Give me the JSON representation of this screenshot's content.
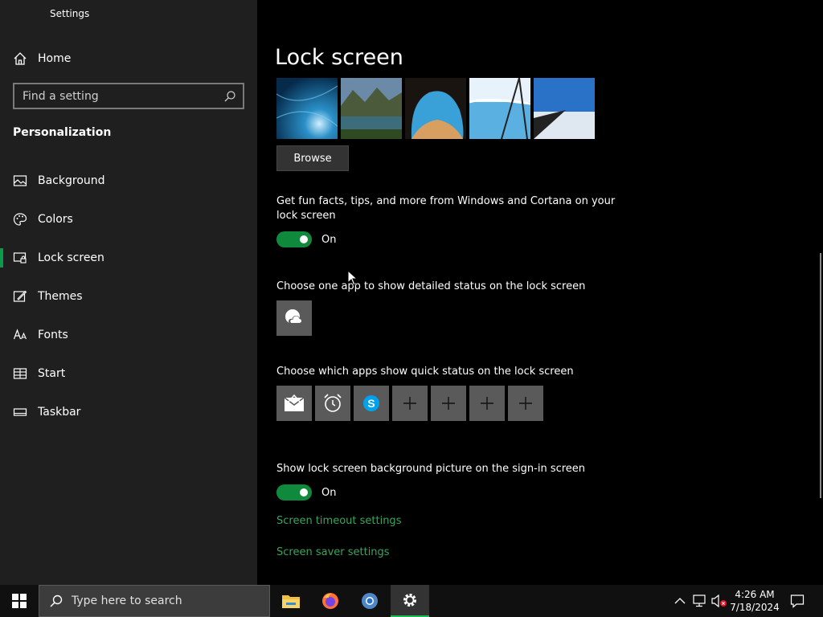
{
  "window": {
    "title": "Settings"
  },
  "sidebar": {
    "home_label": "Home",
    "search_placeholder": "Find a setting",
    "section_title": "Personalization",
    "items": [
      {
        "label": "Background",
        "icon": "image-icon"
      },
      {
        "label": "Colors",
        "icon": "palette-icon"
      },
      {
        "label": "Lock screen",
        "icon": "lock-screen-icon",
        "selected": true
      },
      {
        "label": "Themes",
        "icon": "brush-icon"
      },
      {
        "label": "Fonts",
        "icon": "font-icon"
      },
      {
        "label": "Start",
        "icon": "start-grid-icon"
      },
      {
        "label": "Taskbar",
        "icon": "taskbar-icon"
      }
    ]
  },
  "main": {
    "title": "Lock screen",
    "browse_label": "Browse",
    "fun_facts_text": "Get fun facts, tips, and more from Windows and Cortana on your lock screen",
    "fun_facts_toggle": "On",
    "detailed_status_text": "Choose one app to show detailed status on the lock screen",
    "quick_status_text": "Choose which apps show quick status on the lock screen",
    "signin_bg_text": "Show lock screen background picture on the sign-in screen",
    "signin_bg_toggle": "On",
    "link_timeout": "Screen timeout settings",
    "link_saver": "Screen saver settings"
  },
  "taskbar": {
    "search_placeholder": "Type here to search",
    "time": "4:26 AM",
    "date": "7/18/2024"
  },
  "colors": {
    "accent": "#0f8a3c",
    "link": "#3aa55a",
    "sidebar_bg": "#1f1f1f"
  }
}
